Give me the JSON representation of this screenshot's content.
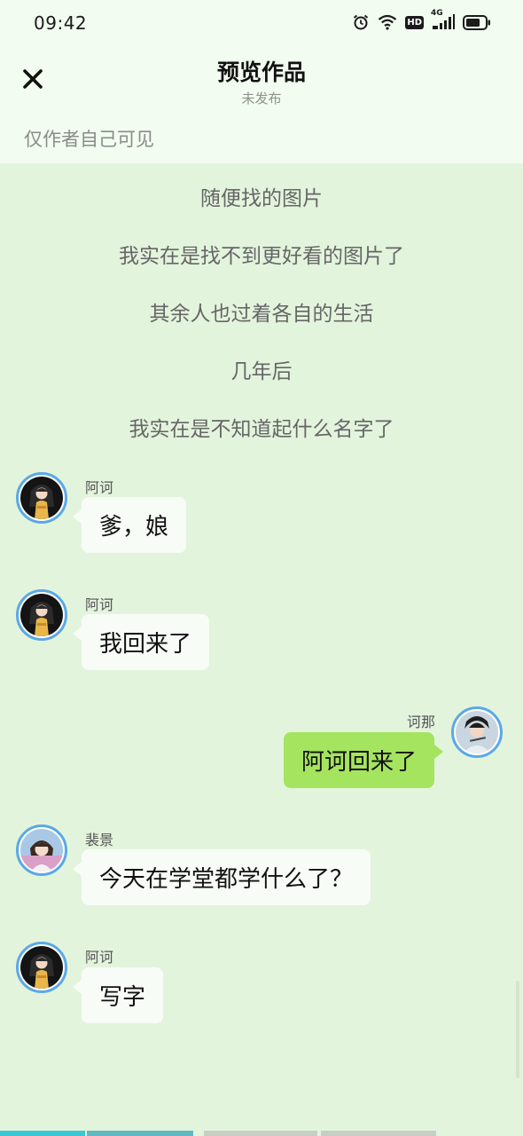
{
  "status_bar": {
    "time": "09:42",
    "icons": [
      "alarm-icon",
      "wifi-icon",
      "hd-icon",
      "signal-4g-icon",
      "battery-icon"
    ],
    "hd_label": "HD",
    "network_label": "4G"
  },
  "header": {
    "close_icon": "close-icon",
    "title": "预览作品",
    "subtitle": "未发布"
  },
  "visibility_note": "仅作者自己可见",
  "narrations": [
    "随便找的图片",
    "我实在是找不到更好看的图片了",
    "其余人也过着各自的生活",
    "几年后",
    "我实在是不知道起什么名字了"
  ],
  "messages": [
    {
      "sender": "阿诃",
      "text": "爹，娘",
      "side": "left"
    },
    {
      "sender": "阿诃",
      "text": "我回来了",
      "side": "left"
    },
    {
      "sender": "诃那",
      "text": "阿诃回来了",
      "side": "right"
    },
    {
      "sender": "裴景",
      "text": "今天在学堂都学什么了？",
      "side": "left"
    },
    {
      "sender": "阿诃",
      "text": "写字",
      "side": "left"
    }
  ],
  "colors": {
    "chat_background": "#e3f4dd",
    "header_background": "#f2fcf0",
    "left_bubble": "#f7fcf6",
    "right_bubble": "#a5e45e",
    "avatar_ring": "#5aa9e6",
    "progress_active": "#3cc7d4"
  }
}
